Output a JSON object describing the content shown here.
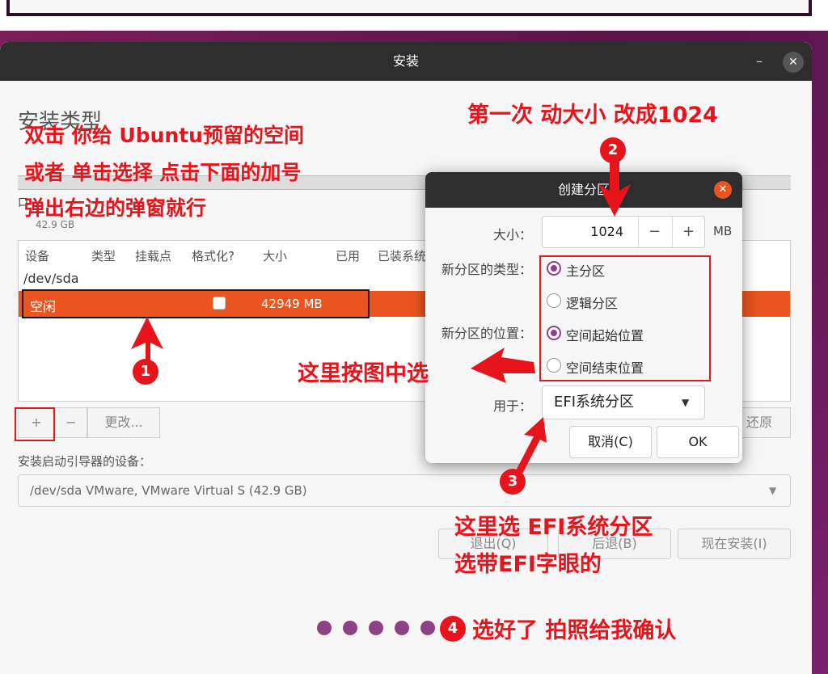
{
  "main_window": {
    "title": "安装",
    "heading": "安装类型",
    "disk_label": "口",
    "disk_size": "42.9 GB",
    "table": {
      "columns": [
        "设备",
        "类型",
        "挂载点",
        "格式化?",
        "大小",
        "已用",
        "已装系统"
      ],
      "device": "/dev/sda",
      "free_row": {
        "label": "空闲",
        "size": "42949 MB"
      }
    },
    "toolbar": {
      "add": "+",
      "remove": "−",
      "change": "更改...",
      "revert": "还原"
    },
    "boot_label": "安装启动引导器的设备：",
    "boot_device": "/dev/sda VMware, VMware Virtual S (42.9 GB)",
    "footer": {
      "quit": "退出(Q)",
      "back": "后退(B)",
      "install": "现在安装(I)"
    },
    "page_dots": 6
  },
  "dialog": {
    "title": "创建分区",
    "size_label": "大小：",
    "size_value": "1024",
    "size_unit": "MB",
    "minus": "−",
    "plus": "+",
    "type_label": "新分区的类型：",
    "type_primary": "主分区",
    "type_logical": "逻辑分区",
    "position_label": "新分区的位置：",
    "position_start": "空间起始位置",
    "position_end": "空间结束位置",
    "use_label": "用于：",
    "use_value": "EFI系统分区",
    "cancel": "取消(C)",
    "ok": "OK"
  },
  "annotations": {
    "instr_line1": "双击 你给 Ubuntu预留的空间",
    "instr_line2": "或者 单击选择 点击下面的加号",
    "instr_line3": "弹出右边的弹窗就行",
    "size_note": "第一次 动大小 改成1024",
    "radio_note": "这里按图中选",
    "efi_note_line1": "这里选 EFI系统分区",
    "efi_note_line2": "选带EFI字眼的",
    "confirm_note": "选好了 拍照给我确认",
    "badge1": "1",
    "badge2": "2",
    "badge3": "3",
    "badge4": "4"
  },
  "colors": {
    "accent_orange": "#e95420",
    "annotation_red": "#e8141b",
    "radio_purple": "#8e4285",
    "titlebar": "#2e2e2e"
  }
}
